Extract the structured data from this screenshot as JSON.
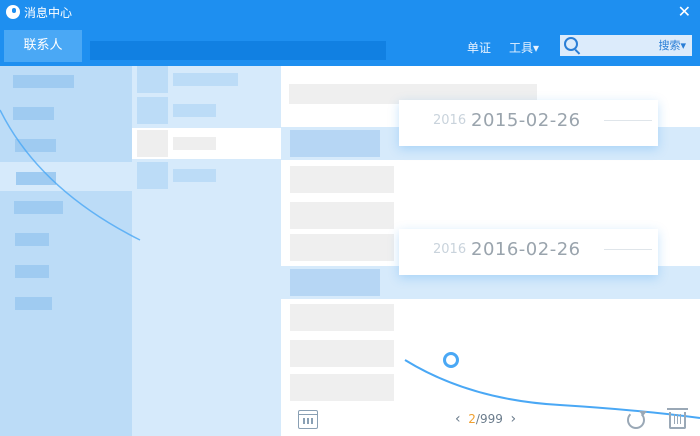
{
  "window": {
    "title": "消息中心",
    "close_glyph": "✕"
  },
  "toolbar": {
    "tab_contacts": "联系人",
    "link_single": "单证",
    "link_tools": "工具",
    "tools_caret": "▾",
    "search_label": "搜索",
    "search_caret": "▾"
  },
  "timeline": [
    {
      "year": "2016",
      "date": "2015-02-26"
    },
    {
      "year": "2016",
      "date": "2016-02-26"
    }
  ],
  "pager": {
    "prev": "‹",
    "current": "2",
    "separator": "/",
    "total": "999",
    "next": "›"
  },
  "colors": {
    "accent": "#1e8ff0",
    "page_current": "#f0a030"
  },
  "icons": [
    "logo-icon",
    "close-icon",
    "search-icon",
    "calendar-icon",
    "refresh-icon",
    "trash-icon"
  ]
}
